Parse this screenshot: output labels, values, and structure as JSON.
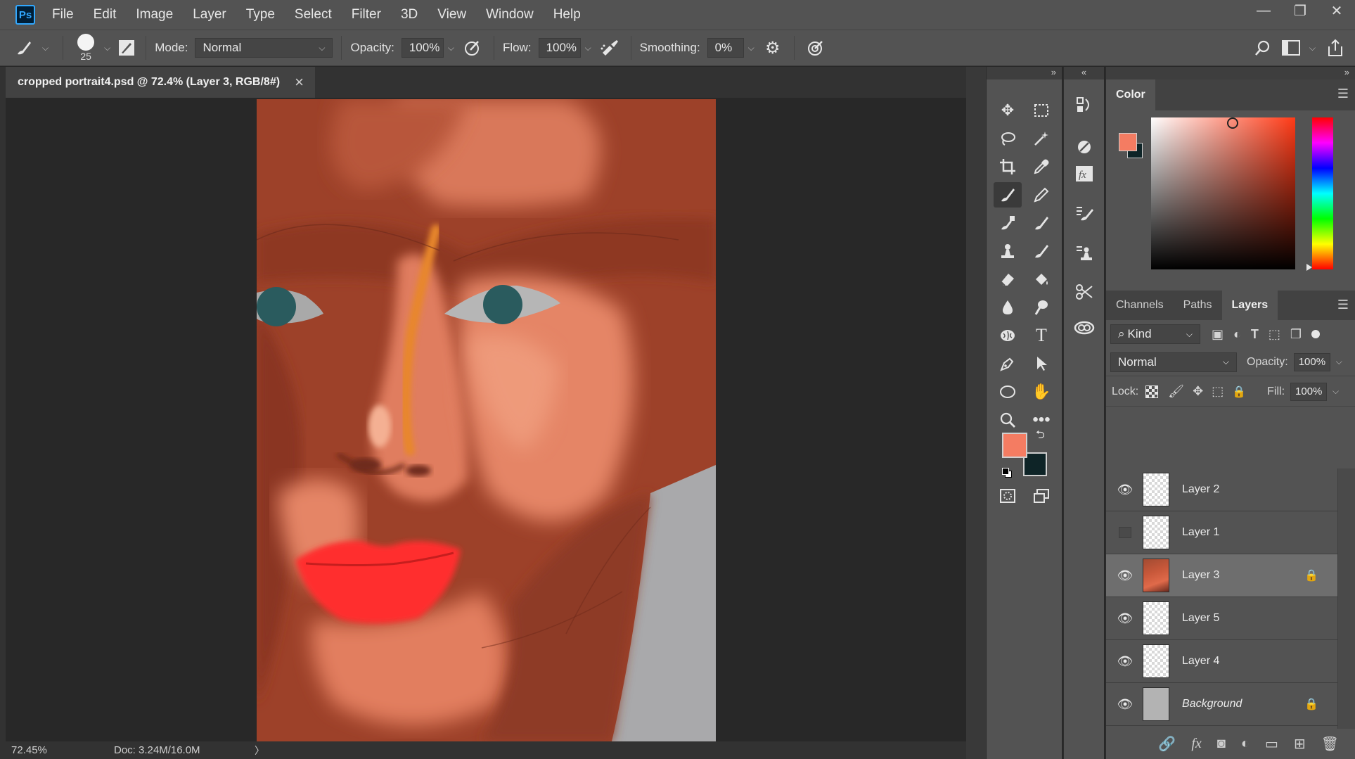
{
  "app": {
    "logo": "Ps",
    "menu": [
      "File",
      "Edit",
      "Image",
      "Layer",
      "Type",
      "Select",
      "Filter",
      "3D",
      "View",
      "Window",
      "Help"
    ]
  },
  "window_controls": {
    "minimize": "—",
    "restore": "❐",
    "close": "✕"
  },
  "options": {
    "brush_size": "25",
    "mode_label": "Mode:",
    "mode_value": "Normal",
    "opacity_label": "Opacity:",
    "opacity_value": "100%",
    "flow_label": "Flow:",
    "flow_value": "100%",
    "smoothing_label": "Smoothing:",
    "smoothing_value": "0%"
  },
  "document_tab": {
    "title": "cropped portrait4.psd @ 72.4% (Layer 3, RGB/8#)",
    "close": "×"
  },
  "status": {
    "zoom": "72.45%",
    "doc": "Doc: 3.24M/16.0M",
    "arrow": "〉"
  },
  "color_panel": {
    "title": "Color",
    "foreground": "#f47c62",
    "background": "#0e2427"
  },
  "layers_panel": {
    "tabs": [
      "Channels",
      "Paths",
      "Layers"
    ],
    "active_tab": "Layers",
    "filter_kind": "Kind",
    "blend_mode": "Normal",
    "opacity_label": "Opacity:",
    "opacity_value": "100%",
    "lock_label": "Lock:",
    "fill_label": "Fill:",
    "fill_value": "100%",
    "layers": [
      {
        "name": "Layer 2",
        "visible": true,
        "selected": false,
        "locked": false,
        "thumb": "transparent"
      },
      {
        "name": "Layer 1",
        "visible": false,
        "selected": false,
        "locked": false,
        "thumb": "transparent"
      },
      {
        "name": "Layer 3",
        "visible": true,
        "selected": true,
        "locked": true,
        "thumb": "face"
      },
      {
        "name": "Layer 5",
        "visible": true,
        "selected": false,
        "locked": false,
        "thumb": "transparent"
      },
      {
        "name": "Layer 4",
        "visible": true,
        "selected": false,
        "locked": false,
        "thumb": "transparent"
      },
      {
        "name": "Background",
        "visible": true,
        "selected": false,
        "locked": true,
        "thumb": "bg"
      }
    ]
  },
  "panel_collapse": {
    "left": "»",
    "mid": "«",
    "right": "»"
  }
}
